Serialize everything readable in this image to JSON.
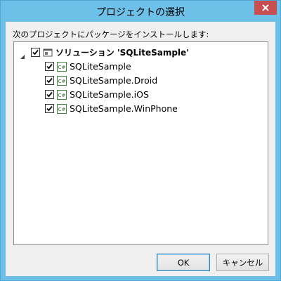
{
  "window": {
    "title": "プロジェクトの選択"
  },
  "instruction": "次のプロジェクトにパッケージをインストールします:",
  "tree": {
    "solution": {
      "label": "ソリューション 'SQLiteSample'",
      "checked": true,
      "expanded": true
    },
    "projects": [
      {
        "label": "SQLiteSample",
        "checked": true,
        "icon": "C#"
      },
      {
        "label": "SQLiteSample.Droid",
        "checked": true,
        "icon": "C#"
      },
      {
        "label": "SQLiteSample.iOS",
        "checked": true,
        "icon": "C#"
      },
      {
        "label": "SQLiteSample.WinPhone",
        "checked": true,
        "icon": "C#"
      }
    ]
  },
  "buttons": {
    "ok": "OK",
    "cancel": "キャンセル"
  }
}
